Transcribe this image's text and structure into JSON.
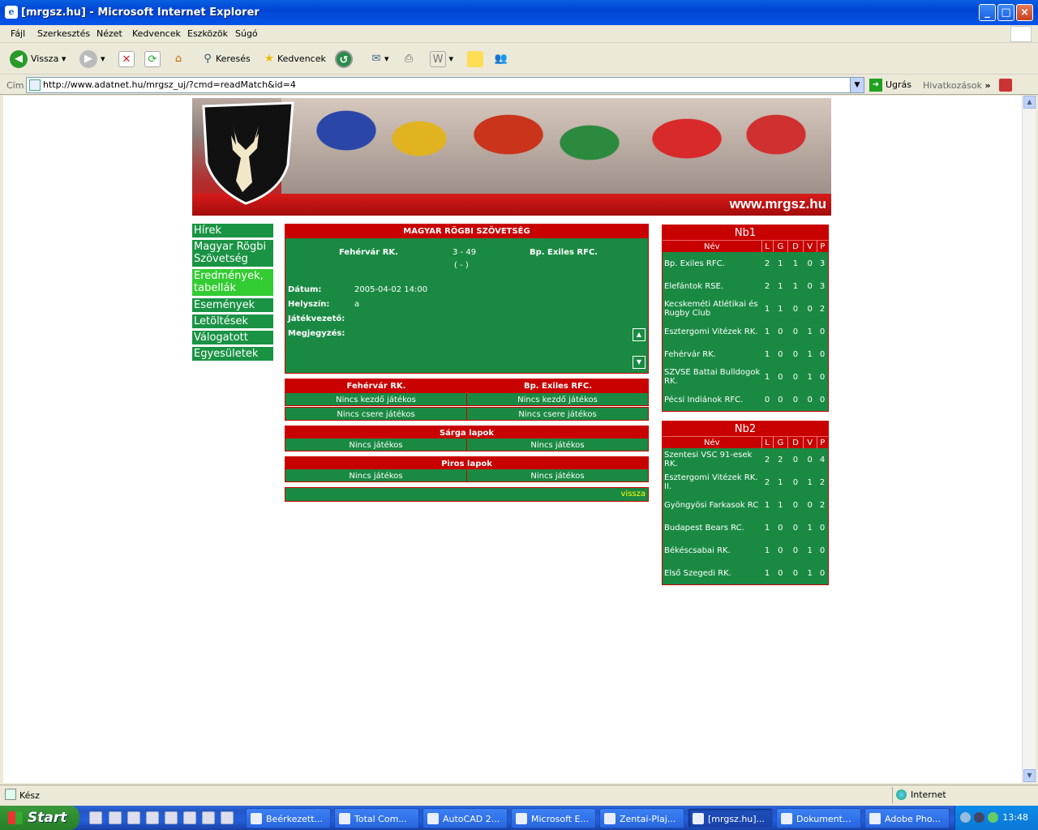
{
  "window": {
    "title": "[mrgsz.hu] - Microsoft Internet Explorer"
  },
  "menu": [
    "Fájl",
    "Szerkesztés",
    "Nézet",
    "Kedvencek",
    "Eszközök",
    "Súgó"
  ],
  "toolbar": {
    "back": "Vissza",
    "search": "Keresés",
    "favorites": "Kedvencek"
  },
  "address": {
    "label": "Cím",
    "url": "http://www.adatnet.hu/mrgsz_uj/?cmd=readMatch&id=4",
    "go": "Ugrás",
    "links": "Hivatkozások"
  },
  "page": {
    "banner_url": "www.mrgsz.hu",
    "nav": [
      "Hírek",
      "Magyar Rögbi Szövetség",
      "Eredmények, tabellák",
      "Események",
      "Letöltések",
      "Válogatott",
      "Egyesületek"
    ],
    "match": {
      "header": "MAGYAR RÖGBI SZÖVETSÉG",
      "home": "Fehérvár RK.",
      "score": "3 - 49",
      "halftime": "( - )",
      "away": "Bp. Exiles RFC.",
      "date_label": "Dátum:",
      "date": "2005-04-02 14:00",
      "venue_label": "Helyszín:",
      "venue": "a",
      "referee_label": "Játékvezető:",
      "note_label": "Megjegyzés:"
    },
    "lineups": {
      "home": "Fehérvár RK.",
      "away": "Bp. Exiles RFC.",
      "home_start": "Nincs kezdő játékos",
      "away_start": "Nincs kezdő játékos",
      "home_sub": "Nincs csere játékos",
      "away_sub": "Nincs csere játékos"
    },
    "yellow": {
      "title": "Sárga lapok",
      "home": "Nincs játékos",
      "away": "Nincs játékos"
    },
    "red": {
      "title": "Piros lapok",
      "home": "Nincs játékos",
      "away": "Nincs játékos"
    },
    "back_link": "vissza",
    "nb1": {
      "title": "Nb1",
      "headers": [
        "Név",
        "L",
        "G",
        "D",
        "V",
        "P"
      ],
      "rows": [
        [
          "Bp. Exiles RFC.",
          "2",
          "1",
          "1",
          "0",
          "3"
        ],
        [
          "Elefántok RSE.",
          "2",
          "1",
          "1",
          "0",
          "3"
        ],
        [
          "Kecskeméti Atlétikai és Rugby Club",
          "1",
          "1",
          "0",
          "0",
          "2"
        ],
        [
          "Esztergomi Vitézek RK.",
          "1",
          "0",
          "0",
          "1",
          "0"
        ],
        [
          "Fehérvár RK.",
          "1",
          "0",
          "0",
          "1",
          "0"
        ],
        [
          "SZVSE Battai Bulldogok RK.",
          "1",
          "0",
          "0",
          "1",
          "0"
        ],
        [
          "Pécsi Indiánok RFC.",
          "0",
          "0",
          "0",
          "0",
          "0"
        ]
      ]
    },
    "nb2": {
      "title": "Nb2",
      "headers": [
        "Név",
        "L",
        "G",
        "D",
        "V",
        "P"
      ],
      "rows": [
        [
          "Szentesi VSC 91-esek RK.",
          "2",
          "2",
          "0",
          "0",
          "4"
        ],
        [
          "Esztergomi Vitézek RK. II.",
          "2",
          "1",
          "0",
          "1",
          "2"
        ],
        [
          "Gyöngyösi Farkasok RC",
          "1",
          "1",
          "0",
          "0",
          "2"
        ],
        [
          "Budapest Bears RC.",
          "1",
          "0",
          "0",
          "1",
          "0"
        ],
        [
          "Békéscsabai RK.",
          "1",
          "0",
          "0",
          "1",
          "0"
        ],
        [
          "Első Szegedi RK.",
          "1",
          "0",
          "0",
          "1",
          "0"
        ]
      ]
    }
  },
  "status": {
    "text": "Kész",
    "zone": "Internet"
  },
  "taskbar": {
    "start": "Start",
    "tasks": [
      "Beérkezett...",
      "Total Com...",
      "AutoCAD 2...",
      "Microsoft E...",
      "Zentai-Plaj...",
      "[mrgsz.hu]...",
      "Dokument...",
      "Adobe Pho..."
    ],
    "clock": "13:48"
  }
}
